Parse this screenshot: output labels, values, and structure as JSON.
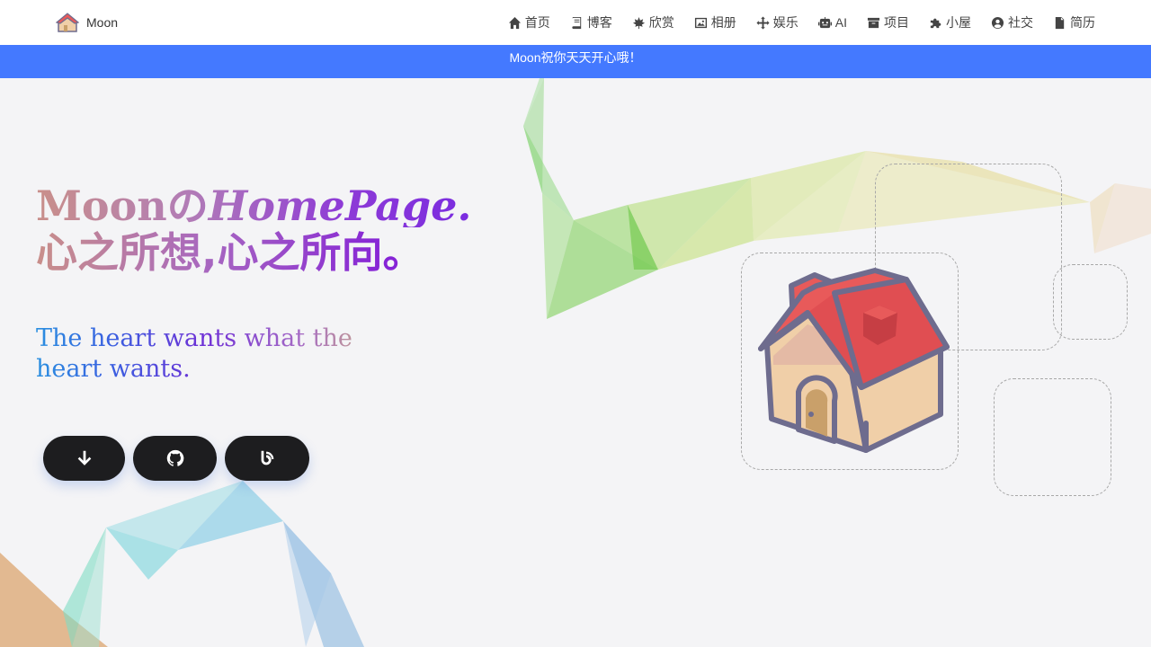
{
  "brand": {
    "name": "Moon",
    "logo_icon": "house-logo-icon"
  },
  "nav": [
    {
      "label": "首页",
      "icon": "home-icon"
    },
    {
      "label": "博客",
      "icon": "book-icon"
    },
    {
      "label": "欣赏",
      "icon": "leaf-icon"
    },
    {
      "label": "相册",
      "icon": "image-icon"
    },
    {
      "label": "娱乐",
      "icon": "gamepad-icon"
    },
    {
      "label": "AI",
      "icon": "robot-icon"
    },
    {
      "label": "项目",
      "icon": "archive-icon"
    },
    {
      "label": "小屋",
      "icon": "puzzle-icon"
    },
    {
      "label": "社交",
      "icon": "user-circle-icon"
    },
    {
      "label": "简历",
      "icon": "file-icon"
    }
  ],
  "banner": {
    "text": "Moon祝你天天开心哦！"
  },
  "hero": {
    "title_part1": "Moonの",
    "title_part2": "HomePage.",
    "title_line2": "心之所想,心之所向。",
    "subtitle": "The heart wants what the heart wants."
  },
  "actions": [
    {
      "name": "scroll-down-button",
      "icon": "arrow-down-icon"
    },
    {
      "name": "github-button",
      "icon": "github-icon"
    },
    {
      "name": "blog-button",
      "icon": "blog-icon"
    }
  ],
  "colors": {
    "banner": "#4479ff",
    "button": "#1d1d1f",
    "roof": "#e85a5a",
    "wall": "#f0cfa8",
    "outline": "#6e6c8e"
  }
}
